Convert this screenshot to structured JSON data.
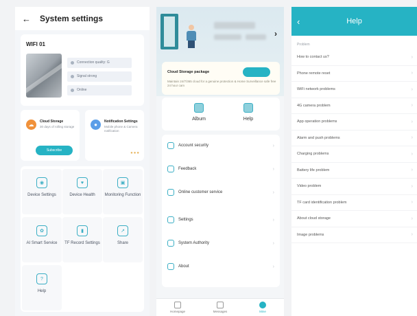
{
  "colors": {
    "accent": "#26b3c4",
    "storage_orange": "#f0913a",
    "notify_blue": "#5b9ee8"
  },
  "settings_screen": {
    "title": "System settings",
    "back_icon": "arrow-left-icon",
    "device": {
      "name": "WIFI 01",
      "info_rows": [
        "Connection quality: G",
        "Signal strong",
        "Online"
      ]
    },
    "services": [
      {
        "title": "Cloud Storage",
        "subtitle": "30 days of rolling storage",
        "icon": "cloud-icon"
      },
      {
        "title": "Notification Settings",
        "subtitle": "Mobile phone & Camera notification",
        "icon": "bell-icon"
      }
    ],
    "storage_button": "Subscribe",
    "tiles": [
      {
        "label": "Device Settings",
        "icon": "device-icon"
      },
      {
        "label": "Device Health",
        "icon": "health-icon"
      },
      {
        "label": "Monitoring Function",
        "icon": "monitor-icon"
      },
      {
        "label": "AI Smart Service",
        "icon": "ai-icon"
      },
      {
        "label": "TF Record Settings",
        "icon": "sd-card-icon"
      },
      {
        "label": "Share",
        "icon": "share-icon"
      },
      {
        "label": "Help",
        "icon": "help-icon"
      }
    ]
  },
  "mine_screen": {
    "storage_card": {
      "title": "Cloud Storage package",
      "subtitle": "Maintain 24/7/365 cloud for a genuine protection & Home Surveillance safe free 24 hour cam"
    },
    "quick": [
      "Album",
      "Help"
    ],
    "menu": [
      {
        "label": "Account security",
        "icon": "shield-icon"
      },
      {
        "label": "Feedback",
        "icon": "edit-icon"
      },
      {
        "label": "Online customer service",
        "icon": "headset-icon"
      },
      {
        "label": "Settings",
        "icon": "gear-icon"
      },
      {
        "label": "System Authority",
        "icon": "key-icon"
      },
      {
        "label": "About",
        "icon": "info-icon"
      }
    ],
    "tabs": [
      {
        "label": "Homepage",
        "icon": "home-icon"
      },
      {
        "label": "Messages",
        "icon": "message-icon"
      },
      {
        "label": "Mine",
        "icon": "user-icon"
      }
    ]
  },
  "help_screen": {
    "title": "Help",
    "section": "Problem",
    "items": [
      "How to contact us?",
      "Phone remote reset",
      "WiFi network problems",
      "4G camera problem",
      "App operation problems",
      "Alarm and push problems",
      "Charging problems",
      "Battery life problem",
      "Video problem",
      "TF card identification problem",
      "About cloud storage",
      "Image problems"
    ]
  }
}
